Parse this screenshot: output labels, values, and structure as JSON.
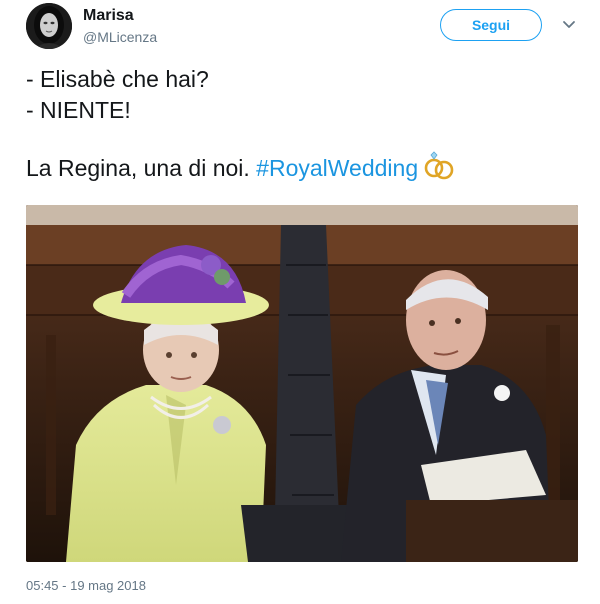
{
  "user": {
    "name": "Marisa",
    "handle": "@MLicenza",
    "follow_label": "Segui"
  },
  "tweet": {
    "lines": [
      "- Elisabè che hai?",
      "- NIENTE!"
    ],
    "text_before_hashtag": "La Regina, una di noi. ",
    "hashtag": "#RoyalWedding",
    "emoji": "rings-icon",
    "timestamp": "05:45 - 19 mag 2018"
  },
  "media": {
    "type": "photo"
  },
  "colors": {
    "accent": "#1da1f2",
    "hashtag": "#1b95e0",
    "secondary_text": "#657786",
    "primary_text": "#14171a"
  }
}
